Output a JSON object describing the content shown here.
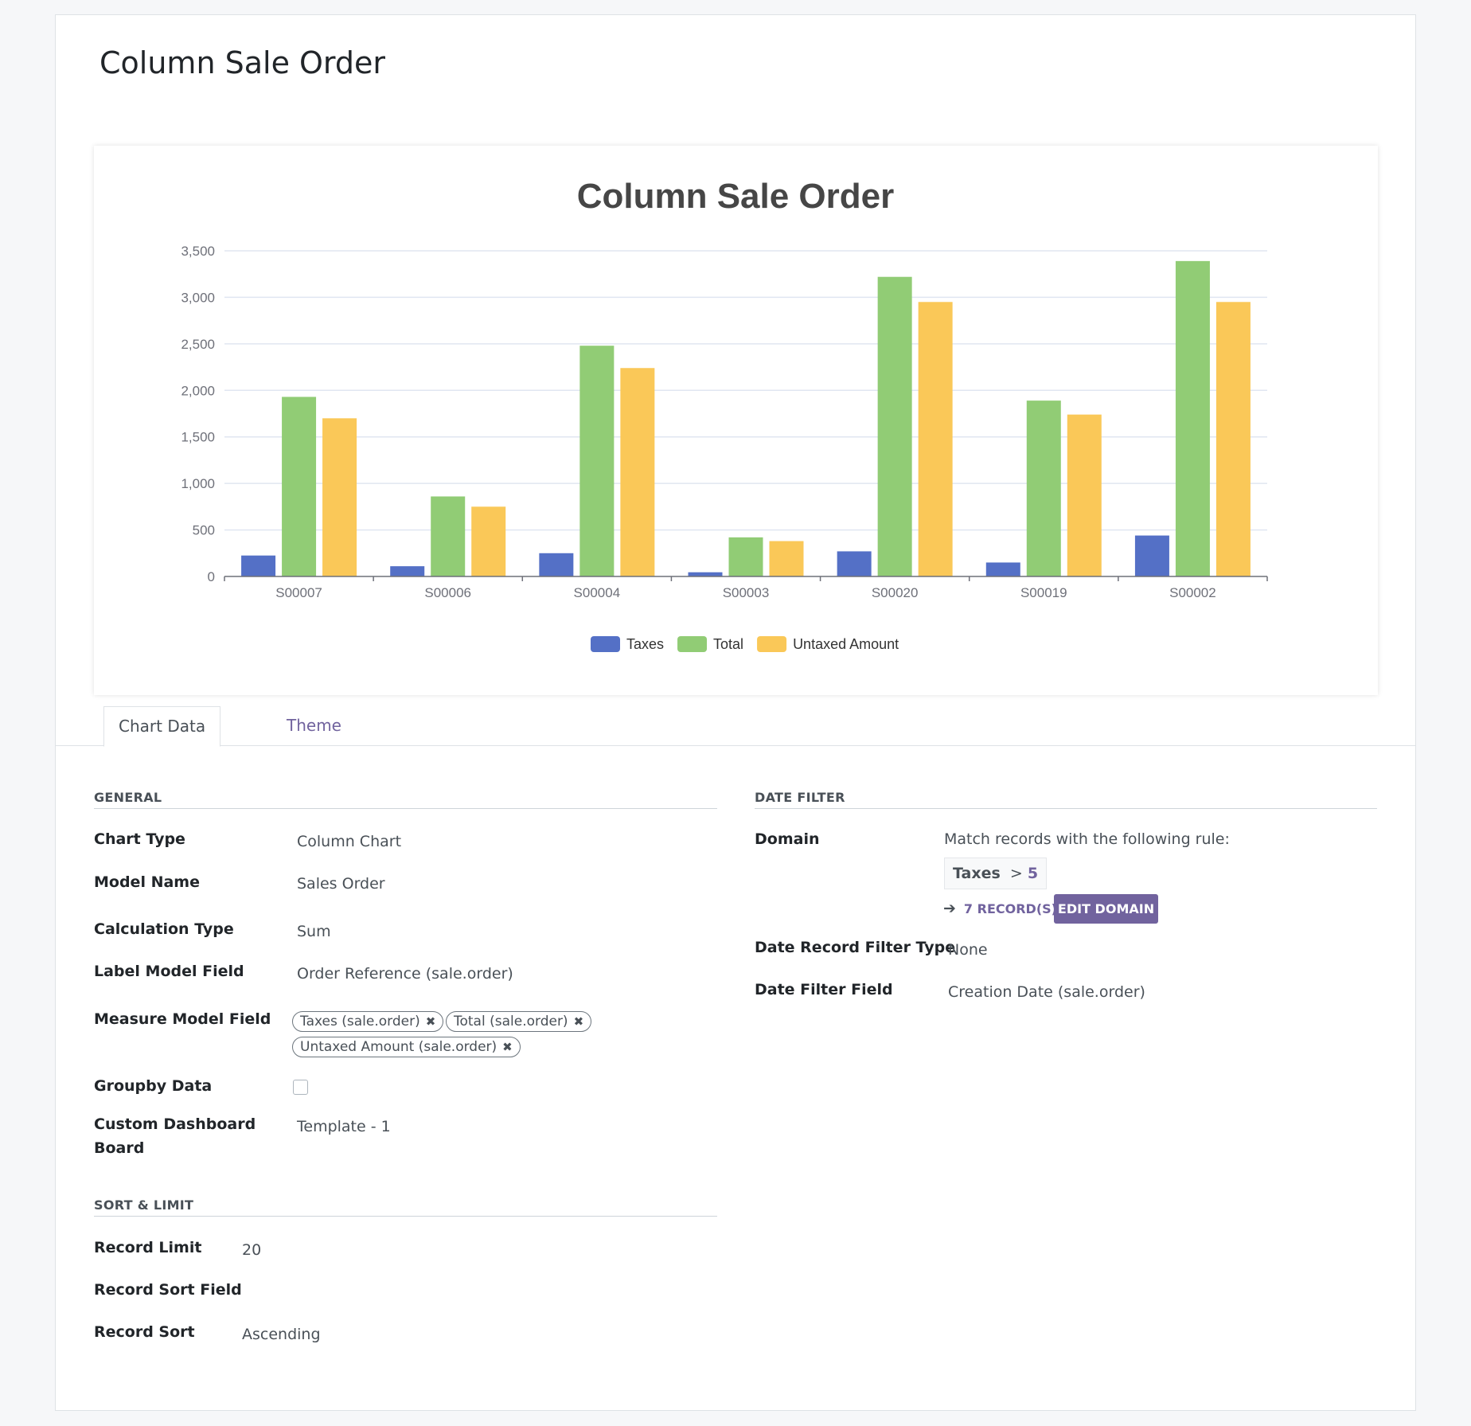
{
  "form": {
    "title": "Column Sale Order"
  },
  "chart_data": {
    "type": "bar",
    "title": "Column Sale Order",
    "categories": [
      "S00007",
      "S00006",
      "S00004",
      "S00003",
      "S00020",
      "S00019",
      "S00002"
    ],
    "series": [
      {
        "name": "Taxes",
        "color": "#5470c6",
        "values": [
          225,
          110,
          250,
          45,
          270,
          150,
          440
        ]
      },
      {
        "name": "Total",
        "color": "#91cc75",
        "values": [
          1930,
          860,
          2480,
          420,
          3220,
          1890,
          3390
        ]
      },
      {
        "name": "Untaxed Amount",
        "color": "#fac858",
        "values": [
          1700,
          750,
          2240,
          380,
          2950,
          1740,
          2950
        ]
      }
    ],
    "ylim": [
      0,
      3500
    ],
    "yticks": [
      "0",
      "500",
      "1,000",
      "1,500",
      "2,000",
      "2,500",
      "3,000",
      "3,500"
    ],
    "ytick_values": [
      0,
      500,
      1000,
      1500,
      2000,
      2500,
      3000,
      3500
    ],
    "grid": true,
    "legend_position": "bottom"
  },
  "tabs": {
    "chart_data": "Chart Data",
    "theme": "Theme"
  },
  "general": {
    "heading": "General",
    "chart_type_label": "Chart Type",
    "chart_type": "Column Chart",
    "model_name_label": "Model Name",
    "model_name": "Sales Order",
    "calc_type_label": "Calculation Type",
    "calc_type": "Sum",
    "label_field_label": "Label Model Field",
    "label_field": "Order Reference (sale.order)",
    "measure_label": "Measure Model Field",
    "measures": [
      "Taxes (sale.order)",
      "Total (sale.order)",
      "Untaxed Amount (sale.order)"
    ],
    "groupby_label": "Groupby Data",
    "board_label_1": "Custom Dashboard",
    "board_label_2": "Board",
    "board": "Template - 1"
  },
  "sort_limit": {
    "heading": "Sort & Limit",
    "limit_label": "Record Limit",
    "limit": "20",
    "sort_field_label": "Record Sort Field",
    "sort_label": "Record Sort",
    "sort": "Ascending"
  },
  "date_filter": {
    "heading": "Date Filter",
    "domain_label": "Domain",
    "domain_intro": "Match records with the following rule:",
    "domain_field": "Taxes",
    "domain_op": ">",
    "domain_value": "5",
    "records": "7 RECORD(S)",
    "edit_button": "EDIT DOMAIN",
    "filter_type_label": "Date Record Filter Type",
    "filter_type": "None",
    "filter_field_label": "Date Filter Field",
    "filter_field": "Creation Date (sale.order)"
  },
  "icons": {
    "arrow": "arrow-right-icon",
    "remove": "remove-tag-icon"
  }
}
